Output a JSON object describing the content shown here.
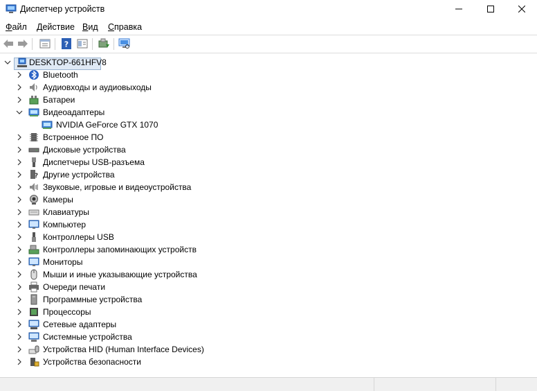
{
  "window": {
    "title": "Диспетчер устройств",
    "controls": [
      "minimize",
      "maximize",
      "close"
    ]
  },
  "menu": {
    "items": [
      {
        "label": "Файл",
        "accel": "Ф",
        "rest": "айл"
      },
      {
        "label": "Действие",
        "accel": "Д",
        "rest": "ействие"
      },
      {
        "label": "Вид",
        "accel": "В",
        "rest": "ид"
      },
      {
        "label": "Справка",
        "accel": "С",
        "rest": "правка"
      }
    ]
  },
  "toolbar": {
    "buttons": [
      "back-icon",
      "forward-icon",
      "properties-icon",
      "help-icon",
      "view-icon",
      "update-driver-icon",
      "scan-hardware-icon"
    ]
  },
  "tree": {
    "root": {
      "label": "DESKTOP-661HFV8",
      "icon": "computer-network-icon",
      "expanded": true
    },
    "items": [
      {
        "label": "Bluetooth",
        "icon": "bluetooth-icon",
        "expanded": false
      },
      {
        "label": "Аудиовходы и аудиовыходы",
        "icon": "speaker-icon",
        "expanded": false
      },
      {
        "label": "Батареи",
        "icon": "battery-icon",
        "expanded": false
      },
      {
        "label": "Видеоадаптеры",
        "icon": "display-adapter-icon",
        "expanded": true,
        "children": [
          {
            "label": "NVIDIA GeForce GTX 1070",
            "icon": "display-adapter-icon"
          }
        ]
      },
      {
        "label": "Встроенное ПО",
        "icon": "firmware-icon",
        "expanded": false
      },
      {
        "label": "Дисковые устройства",
        "icon": "disk-drive-icon",
        "expanded": false
      },
      {
        "label": "Диспетчеры USB-разъема",
        "icon": "usb-connector-icon",
        "expanded": false
      },
      {
        "label": "Другие устройства",
        "icon": "unknown-device-icon",
        "expanded": false
      },
      {
        "label": "Звуковые, игровые и видеоустройства",
        "icon": "sound-icon",
        "expanded": false
      },
      {
        "label": "Камеры",
        "icon": "camera-icon",
        "expanded": false
      },
      {
        "label": "Клавиатуры",
        "icon": "keyboard-icon",
        "expanded": false
      },
      {
        "label": "Компьютер",
        "icon": "monitor-icon",
        "expanded": false
      },
      {
        "label": "Контроллеры USB",
        "icon": "usb-icon",
        "expanded": false
      },
      {
        "label": "Контроллеры запоминающих устройств",
        "icon": "storage-controller-icon",
        "expanded": false
      },
      {
        "label": "Мониторы",
        "icon": "monitor-icon",
        "expanded": false
      },
      {
        "label": "Мыши и иные указывающие устройства",
        "icon": "mouse-icon",
        "expanded": false
      },
      {
        "label": "Очереди печати",
        "icon": "printer-icon",
        "expanded": false
      },
      {
        "label": "Программные устройства",
        "icon": "software-device-icon",
        "expanded": false
      },
      {
        "label": "Процессоры",
        "icon": "processor-icon",
        "expanded": false
      },
      {
        "label": "Сетевые адаптеры",
        "icon": "network-adapter-icon",
        "expanded": false
      },
      {
        "label": "Системные устройства",
        "icon": "system-device-icon",
        "expanded": false
      },
      {
        "label": "Устройства HID (Human Interface Devices)",
        "icon": "hid-icon",
        "expanded": false
      },
      {
        "label": "Устройства безопасности",
        "icon": "security-device-icon",
        "expanded": false
      }
    ]
  },
  "colors": {
    "selection_bg": "#dfe9f5",
    "selection_border": "#99b4d1",
    "icon_blue": "#3a7bd5",
    "icon_green": "#5aa05a"
  }
}
